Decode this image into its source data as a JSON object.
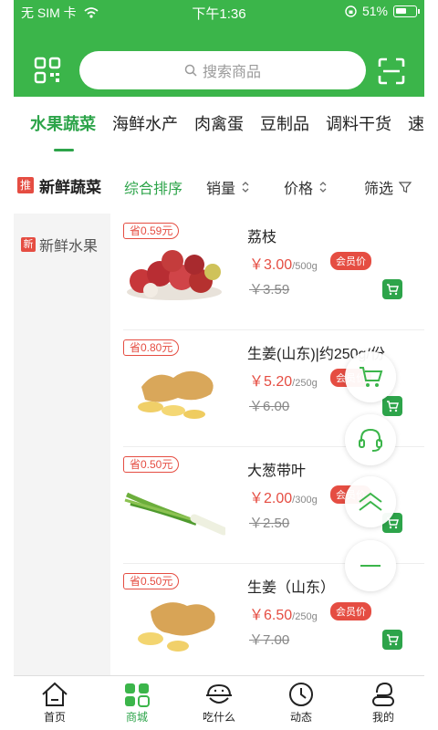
{
  "status": {
    "carrier": "无 SIM 卡",
    "time": "下午1:36",
    "battery": "51%"
  },
  "header": {
    "search_placeholder": "搜索商品"
  },
  "categories": [
    {
      "label": "水果蔬菜",
      "active": true
    },
    {
      "label": "海鲜水产"
    },
    {
      "label": "肉禽蛋"
    },
    {
      "label": "豆制品"
    },
    {
      "label": "调料干货"
    },
    {
      "label": "速"
    }
  ],
  "section": {
    "badge": "推",
    "title": "新鲜蔬菜"
  },
  "sort": {
    "comprehensive": "综合排序",
    "sales": "销量",
    "price": "价格",
    "filter": "筛选"
  },
  "left_menu": [
    {
      "badge": "新",
      "label": "新鲜水果"
    }
  ],
  "products": [
    {
      "save": "省0.59元",
      "name": "荔枝",
      "price": "￥3.00",
      "unit": "/500g",
      "member": "会员价",
      "old_price": "￥3.59",
      "image": "lychee"
    },
    {
      "save": "省0.80元",
      "name": "生姜(山东)|约250g/份",
      "price": "￥5.20",
      "unit": "/250g",
      "member": "会员价",
      "old_price": "￥6.00",
      "image": "ginger"
    },
    {
      "save": "省0.50元",
      "name": "大葱带叶",
      "price": "￥2.00",
      "unit": "/300g",
      "member": "会员价",
      "old_price": "￥2.50",
      "image": "scallion"
    },
    {
      "save": "省0.50元",
      "name": "生姜（山东）",
      "price": "￥6.50",
      "unit": "/250g",
      "member": "会员价",
      "old_price": "￥7.00",
      "image": "ginger"
    }
  ],
  "nav": [
    {
      "label": "首页",
      "icon": "home-icon"
    },
    {
      "label": "商城",
      "icon": "mall-icon",
      "active": true
    },
    {
      "label": "吃什么",
      "icon": "bowl-icon"
    },
    {
      "label": "动态",
      "icon": "feed-icon"
    },
    {
      "label": "我的",
      "icon": "profile-icon"
    }
  ],
  "colors": {
    "brand": "#3bb54a",
    "accent_green": "#2da44a",
    "red": "#e54d42"
  }
}
